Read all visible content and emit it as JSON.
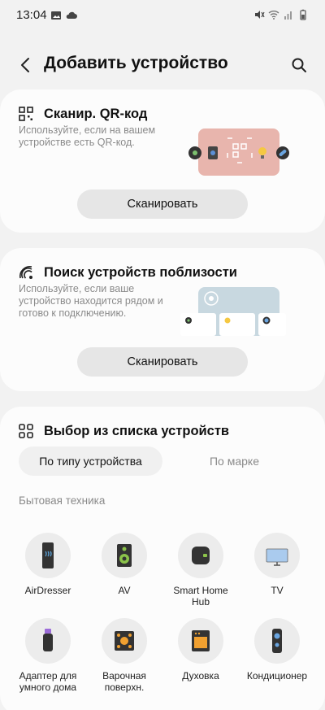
{
  "status": {
    "time": "13:04"
  },
  "header": {
    "title": "Добавить устройство"
  },
  "qr_card": {
    "title": "Сканир. QR-код",
    "description": "Используйте, если на вашем устройстве есть QR-код.",
    "button": "Сканировать"
  },
  "nearby_card": {
    "title": "Поиск устройств поблизости",
    "description": "Используйте, если ваше устройство находится рядом и готово к подключению.",
    "button": "Сканировать"
  },
  "list_card": {
    "title": "Выбор из списка устройств",
    "tabs": [
      "По типу устройства",
      "По марке"
    ],
    "section": "Бытовая техника",
    "devices": [
      {
        "label": "AirDresser",
        "icon": "airdresser-icon"
      },
      {
        "label": "AV",
        "icon": "speaker-icon"
      },
      {
        "label": "Smart Home Hub",
        "icon": "hub-icon"
      },
      {
        "label": "TV",
        "icon": "tv-icon"
      },
      {
        "label": "Адаптер для умного дома",
        "icon": "adapter-icon"
      },
      {
        "label": "Варочная поверхн.",
        "icon": "cooktop-icon"
      },
      {
        "label": "Духовка",
        "icon": "oven-icon"
      },
      {
        "label": "Кондиционер",
        "icon": "air-conditioner-icon"
      }
    ]
  },
  "colors": {
    "qr_illustration": "#e8b5ad",
    "nearby_illustration": "#c8d8e0"
  }
}
